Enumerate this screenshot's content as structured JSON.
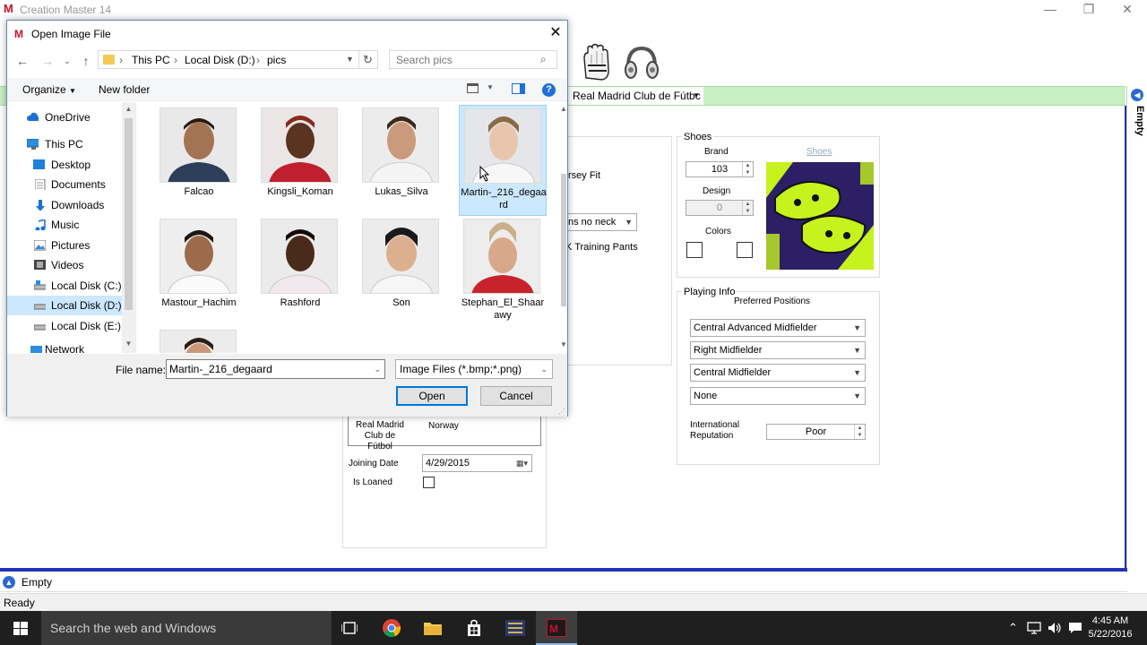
{
  "app": {
    "title": "Creation Master 14",
    "logo": "M",
    "club_select": "Real Madrid Club de Fútbc",
    "right_tab_label": "Empty",
    "bottom_tab_label": "Empty",
    "status": "Ready"
  },
  "bg_form": {
    "jersey_fit": "rsey Fit",
    "neck": "ns no neck",
    "training_pants": "K Training Pants",
    "club_name": "Real Madrid Club de Fútbol",
    "country": "Norway",
    "joining_date_label": "Joining Date",
    "joining_date": "4/29/2015",
    "is_loaned_label": "Is Loaned",
    "shoes": {
      "title": "Shoes",
      "brand_label": "Brand",
      "brand_value": "103",
      "link": "Shoes",
      "design_label": "Design",
      "design_value": "0",
      "colors_label": "Colors"
    },
    "playing_info": {
      "title": "Playing Info",
      "preferred_positions_label": "Preferred Positions",
      "positions": [
        "Central Advanced Midfielder",
        "Right Midfielder",
        "Central Midfielder",
        "None"
      ],
      "reputation_label": "International Reputation",
      "reputation_value": "Poor"
    }
  },
  "dialog": {
    "title": "Open Image File",
    "breadcrumbs": [
      "This PC",
      "Local Disk (D:)",
      "pics"
    ],
    "search_placeholder": "Search pics",
    "organize": "Organize",
    "new_folder": "New folder",
    "nav_items": [
      {
        "label": "OneDrive",
        "icon": "cloud-icon"
      },
      {
        "label": "This PC",
        "icon": "computer-icon"
      },
      {
        "label": "Desktop",
        "icon": "desktop-icon"
      },
      {
        "label": "Documents",
        "icon": "documents-icon"
      },
      {
        "label": "Downloads",
        "icon": "download-icon"
      },
      {
        "label": "Music",
        "icon": "music-icon"
      },
      {
        "label": "Pictures",
        "icon": "pictures-icon"
      },
      {
        "label": "Videos",
        "icon": "videos-icon"
      },
      {
        "label": "Local Disk (C:)",
        "icon": "drive-icon"
      },
      {
        "label": "Local Disk (D:)",
        "icon": "drive-icon"
      },
      {
        "label": "Local Disk (E:)",
        "icon": "drive-icon"
      },
      {
        "label": "Network",
        "icon": "network-icon"
      }
    ],
    "files": [
      {
        "name": "Falcao"
      },
      {
        "name": "Kingsli_Koman"
      },
      {
        "name": "Lukas_Silva"
      },
      {
        "name": "Martin-_216_degaard"
      },
      {
        "name": "Mastour_Hachim"
      },
      {
        "name": "Rashford"
      },
      {
        "name": "Son"
      },
      {
        "name": "Stephan_El_Shaarawy"
      }
    ],
    "file_name_label": "File name:",
    "file_name_value": "Martin-_216_degaard",
    "file_type": "Image Files (*.bmp;*.png)",
    "open_label": "Open",
    "cancel_label": "Cancel"
  },
  "taskbar": {
    "search_placeholder": "Search the web and Windows",
    "time": "4:45 AM",
    "date": "5/22/2016"
  },
  "colors": {
    "accent_blue": "#2234b6",
    "tab_green": "#c9f0c4",
    "selection": "#cce8ff",
    "logo_red": "#c8102e"
  }
}
